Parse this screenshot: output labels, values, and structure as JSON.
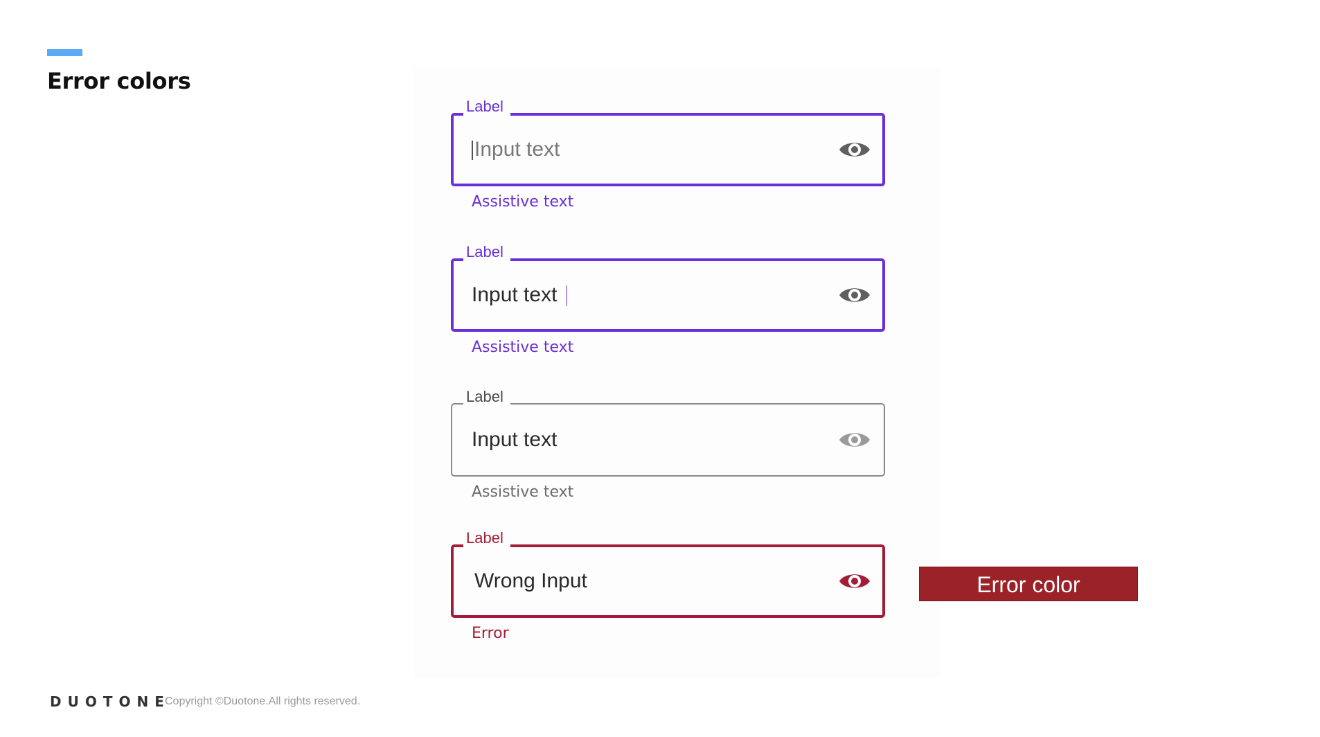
{
  "slide": {
    "title": "Error colors",
    "accent_color": "#5aaaf5"
  },
  "fields": [
    {
      "state": "focused-empty",
      "label": "Label",
      "input": "Input text",
      "assistive": "Assistive text",
      "color": "#6a2fd6",
      "icon": "eye-icon"
    },
    {
      "state": "focused-filled",
      "label": "Label",
      "input": "Input text",
      "assistive": "Assistive text",
      "color": "#6a2fd6",
      "icon": "eye-icon"
    },
    {
      "state": "inactive",
      "label": "Label",
      "input": "Input text",
      "assistive": "Assistive text",
      "color": "#8a8a8a",
      "icon": "eye-icon"
    },
    {
      "state": "error",
      "label": "Label",
      "input": "Wrong Input",
      "assistive": "Error",
      "color": "#a31d36",
      "icon": "eye-icon"
    }
  ],
  "error_swatch": {
    "label": "Error color",
    "color": "#9b2226"
  },
  "footer": {
    "brand": "DUOTONE",
    "copyright": "Copyright ©Duotone.All rights reserved."
  }
}
